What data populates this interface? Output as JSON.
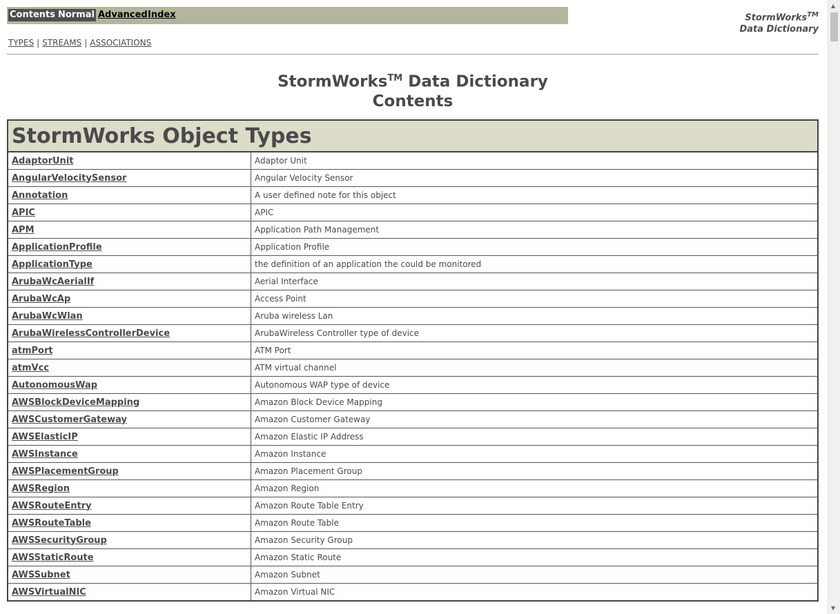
{
  "tabs": [
    {
      "label": "Contents",
      "active": true
    },
    {
      "label": "Normal",
      "active": true
    },
    {
      "label": "Advanced",
      "active": false
    },
    {
      "label": "Index",
      "active": false
    }
  ],
  "brand": {
    "name": "StormWorks",
    "tm": "TM",
    "subtitle": "Data Dictionary"
  },
  "subnav": [
    "TYPES",
    "STREAMS",
    "ASSOCIATIONS"
  ],
  "heading": {
    "line1_name": "StormWorks",
    "line1_tm": "TM",
    "line1_rest": " Data Dictionary",
    "line2": "Contents"
  },
  "section_title": "StormWorks Object Types",
  "types": [
    {
      "name": "AdaptorUnit",
      "desc": "Adaptor Unit"
    },
    {
      "name": "AngularVelocitySensor",
      "desc": "Angular Velocity Sensor"
    },
    {
      "name": "Annotation",
      "desc": "A user defined note for this object"
    },
    {
      "name": "APIC",
      "desc": "APIC"
    },
    {
      "name": "APM",
      "desc": "Application Path Management"
    },
    {
      "name": "ApplicationProfile",
      "desc": "Application Profile"
    },
    {
      "name": "ApplicationType",
      "desc": "the definition of an application the could be monitored"
    },
    {
      "name": "ArubaWcAerialIf",
      "desc": "Aerial Interface"
    },
    {
      "name": "ArubaWcAp",
      "desc": "Access Point"
    },
    {
      "name": "ArubaWcWlan",
      "desc": "Aruba wireless Lan"
    },
    {
      "name": "ArubaWirelessControllerDevice",
      "desc": "ArubaWireless Controller type of device"
    },
    {
      "name": "atmPort",
      "desc": "ATM Port"
    },
    {
      "name": "atmVcc",
      "desc": "ATM virtual channel"
    },
    {
      "name": "AutonomousWap",
      "desc": "Autonomous WAP type of device"
    },
    {
      "name": "AWSBlockDeviceMapping",
      "desc": "Amazon Block Device Mapping"
    },
    {
      "name": "AWSCustomerGateway",
      "desc": "Amazon Customer Gateway"
    },
    {
      "name": "AWSElasticIP",
      "desc": "Amazon Elastic IP Address"
    },
    {
      "name": "AWSInstance",
      "desc": "Amazon Instance"
    },
    {
      "name": "AWSPlacementGroup",
      "desc": "Amazon Placement Group"
    },
    {
      "name": "AWSRegion",
      "desc": "Amazon Region"
    },
    {
      "name": "AWSRouteEntry",
      "desc": "Amazon Route Table Entry"
    },
    {
      "name": "AWSRouteTable",
      "desc": "Amazon Route Table"
    },
    {
      "name": "AWSSecurityGroup",
      "desc": "Amazon Security Group"
    },
    {
      "name": "AWSStaticRoute",
      "desc": "Amazon Static Route"
    },
    {
      "name": "AWSSubnet",
      "desc": "Amazon Subnet"
    },
    {
      "name": "AWSVirtualNIC",
      "desc": "Amazon Virtual NIC"
    }
  ],
  "colors": {
    "header_bar": "#b5b59c",
    "section_header": "#dcdcc8",
    "text": "#4a4a4a"
  }
}
